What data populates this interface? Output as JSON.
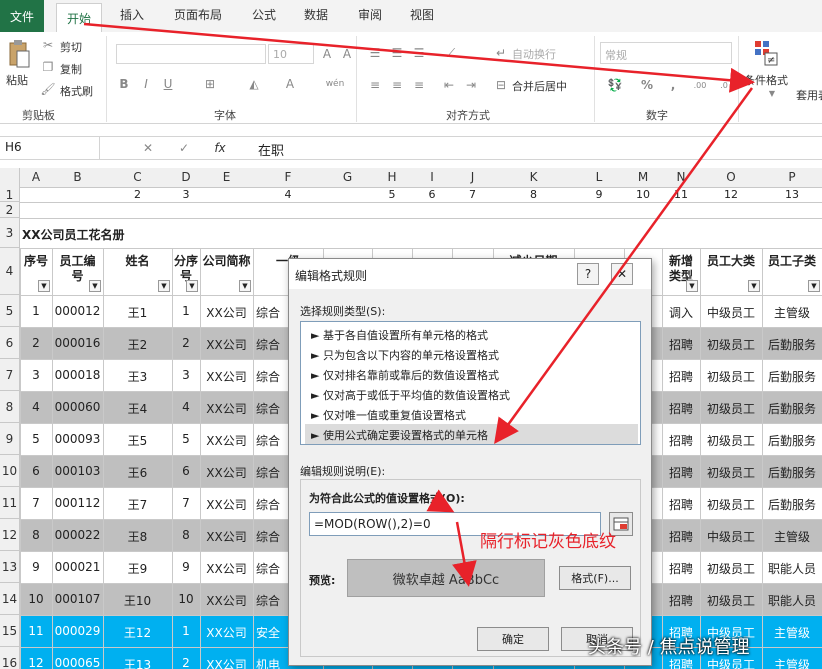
{
  "ribbon": {
    "tabs": [
      "文件",
      "开始",
      "插入",
      "页面布局",
      "公式",
      "数据",
      "审阅",
      "视图"
    ],
    "clipboard": {
      "paste": "粘贴",
      "cut": "剪切",
      "copy": "复制",
      "format_painter": "格式刷",
      "label": "剪贴板"
    },
    "font": {
      "size": "10",
      "label": "字体"
    },
    "alignment": {
      "wrap": "自动换行",
      "merge": "合并后居中",
      "label": "对齐方式"
    },
    "number": {
      "format": "常规",
      "label": "数字"
    },
    "styles": {
      "conditional": "条件格式",
      "table": "套用表格"
    }
  },
  "formula_bar": {
    "cell": "H6",
    "value": "在职"
  },
  "columns": [
    {
      "letter": "A",
      "num": ""
    },
    {
      "letter": "B",
      "num": ""
    },
    {
      "letter": "C",
      "num": "2"
    },
    {
      "letter": "D",
      "num": "3"
    },
    {
      "letter": "E",
      "num": ""
    },
    {
      "letter": "F",
      "num": "4"
    },
    {
      "letter": "G",
      "num": ""
    },
    {
      "letter": "H",
      "num": "5"
    },
    {
      "letter": "I",
      "num": "6"
    },
    {
      "letter": "J",
      "num": "7"
    },
    {
      "letter": "K",
      "num": "8"
    },
    {
      "letter": "L",
      "num": "9"
    },
    {
      "letter": "M",
      "num": "10"
    },
    {
      "letter": "N",
      "num": "11"
    },
    {
      "letter": "O",
      "num": "12"
    },
    {
      "letter": "P",
      "num": "13"
    }
  ],
  "sheet": {
    "title": "XX公司员工花名册",
    "headers": [
      "序号",
      "员工编号",
      "姓名",
      "分序号",
      "公司简称",
      "一级",
      "减少日期",
      "新增类型",
      "员工大类",
      "员工子类"
    ],
    "rows": [
      {
        "num": "1",
        "id": "000012",
        "name": "王1",
        "sub": "1",
        "co": "XX公司",
        "dept": "综合",
        "type": "调入",
        "cat": "中级员工",
        "subcat": "主管级"
      },
      {
        "num": "2",
        "id": "000016",
        "name": "王2",
        "sub": "2",
        "co": "XX公司",
        "dept": "综合",
        "type": "招聘",
        "cat": "初级员工",
        "subcat": "后勤服务"
      },
      {
        "num": "3",
        "id": "000018",
        "name": "王3",
        "sub": "3",
        "co": "XX公司",
        "dept": "综合",
        "type": "招聘",
        "cat": "初级员工",
        "subcat": "后勤服务"
      },
      {
        "num": "4",
        "id": "000060",
        "name": "王4",
        "sub": "4",
        "co": "XX公司",
        "dept": "综合",
        "type": "招聘",
        "cat": "初级员工",
        "subcat": "后勤服务"
      },
      {
        "num": "5",
        "id": "000093",
        "name": "王5",
        "sub": "5",
        "co": "XX公司",
        "dept": "综合",
        "type": "招聘",
        "cat": "初级员工",
        "subcat": "后勤服务"
      },
      {
        "num": "6",
        "id": "000103",
        "name": "王6",
        "sub": "6",
        "co": "XX公司",
        "dept": "综合",
        "type": "招聘",
        "cat": "初级员工",
        "subcat": "后勤服务"
      },
      {
        "num": "7",
        "id": "000112",
        "name": "王7",
        "sub": "7",
        "co": "XX公司",
        "dept": "综合",
        "type": "招聘",
        "cat": "初级员工",
        "subcat": "后勤服务"
      },
      {
        "num": "8",
        "id": "000022",
        "name": "王8",
        "sub": "8",
        "co": "XX公司",
        "dept": "综合",
        "type": "招聘",
        "cat": "中级员工",
        "subcat": "主管级"
      },
      {
        "num": "9",
        "id": "000021",
        "name": "王9",
        "sub": "9",
        "co": "XX公司",
        "dept": "综合",
        "type": "招聘",
        "cat": "初级员工",
        "subcat": "职能人员"
      },
      {
        "num": "10",
        "id": "000107",
        "name": "王10",
        "sub": "10",
        "co": "XX公司",
        "dept": "综合",
        "type": "招聘",
        "cat": "初级员工",
        "subcat": "职能人员"
      },
      {
        "num": "11",
        "id": "000029",
        "name": "王12",
        "sub": "1",
        "co": "XX公司",
        "dept": "安全",
        "type": "招聘",
        "cat": "中级员工",
        "subcat": "主管级"
      },
      {
        "num": "12",
        "id": "000065",
        "name": "王13",
        "sub": "2",
        "co": "XX公司",
        "dept": "机电",
        "type": "招聘",
        "cat": "中级员工",
        "subcat": "主管级"
      }
    ]
  },
  "dialog": {
    "title": "编辑格式规则",
    "select_label": "选择规则类型(S):",
    "rule_types": [
      "► 基于各自值设置所有单元格的格式",
      "► 只为包含以下内容的单元格设置格式",
      "► 仅对排名靠前或靠后的数值设置格式",
      "► 仅对高于或低于平均值的数值设置格式",
      "► 仅对唯一值或重复值设置格式",
      "► 使用公式确定要设置格式的单元格"
    ],
    "edit_label": "编辑规则说明(E):",
    "formula_label": "为符合此公式的值设置格式(O):",
    "formula": "=MOD(ROW(),2)=0",
    "preview_label": "预览:",
    "preview_text": "微软卓越   AaBbCc",
    "format_button": "格式(F)...",
    "ok_button": "确定",
    "cancel_button": "取消"
  },
  "annotation": "隔行标记灰色底纹",
  "watermark": "头条号 / 焦点说管理",
  "colors": {
    "accent": "#217346",
    "gray_row": "#bfbfbf",
    "blue_row": "#00b0f0",
    "arrow": "#e8222a"
  }
}
